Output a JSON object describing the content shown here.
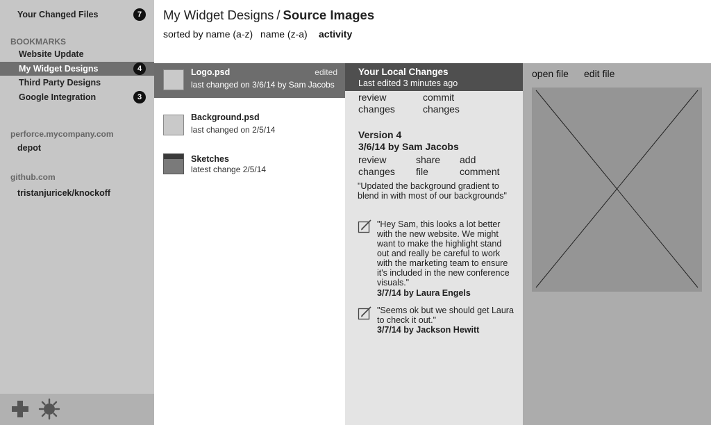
{
  "sidebar": {
    "changed_files": {
      "label": "Your Changed Files",
      "count": "7"
    },
    "bookmarks_heading": "BOOKMARKS",
    "bookmarks": [
      {
        "label": "Website Update",
        "badge": ""
      },
      {
        "label": "My Widget Designs",
        "badge": "4"
      },
      {
        "label": "Third Party Designs",
        "badge": ""
      },
      {
        "label": "Google Integration",
        "badge": "3"
      }
    ],
    "servers": [
      {
        "heading": "perforce.mycompany.com",
        "item": "depot"
      },
      {
        "heading": "github.com",
        "item": "tristanjuricek/knockoff"
      }
    ],
    "footer_icons": [
      "add-icon",
      "settings-gear-icon"
    ]
  },
  "header": {
    "breadcrumb_parent": "My Widget Designs",
    "breadcrumb_separator": "/",
    "breadcrumb_current": "Source Images",
    "sort_options": [
      "sorted by name (a-z)",
      "name (z-a)",
      "activity"
    ]
  },
  "files": [
    {
      "name": "Logo.psd",
      "meta": "last changed on 3/6/14 by Sam Jacobs",
      "status": "edited",
      "selected": true
    },
    {
      "name": "Background.psd",
      "meta": "last changed on 2/5/14",
      "status": ""
    },
    {
      "name": "Sketches",
      "meta": "latest change 2/5/14",
      "status": ""
    }
  ],
  "details": {
    "local_title": "Your Local Changes",
    "local_subtitle": "Last edited 3 minutes ago",
    "local_actions": [
      {
        "line1": "review",
        "line2": "changes"
      },
      {
        "line1": "commit",
        "line2": "changes"
      }
    ],
    "version_title": "Version 4",
    "version_byline": "3/6/14 by Sam Jacobs",
    "version_actions": [
      {
        "line1": "review",
        "line2": "changes"
      },
      {
        "line1": "share",
        "line2": "file"
      },
      {
        "line1": "add",
        "line2": "comment"
      }
    ],
    "commit_message": "\"Updated the background gradient to blend in with most of our backgrounds\"",
    "comments": [
      {
        "text": "\"Hey Sam, this looks a lot better with the new website. We might want to make the highlight stand out and really be careful to work with the marketing team to ensure it's included in the new conference visuals.\"",
        "by": "3/7/14 by Laura Engels"
      },
      {
        "text": "\"Seems ok but we should get Laura to check it out.\"",
        "by": "3/7/14 by Jackson Hewitt"
      }
    ]
  },
  "preview": {
    "open_label": "open file",
    "edit_label": "edit file"
  }
}
